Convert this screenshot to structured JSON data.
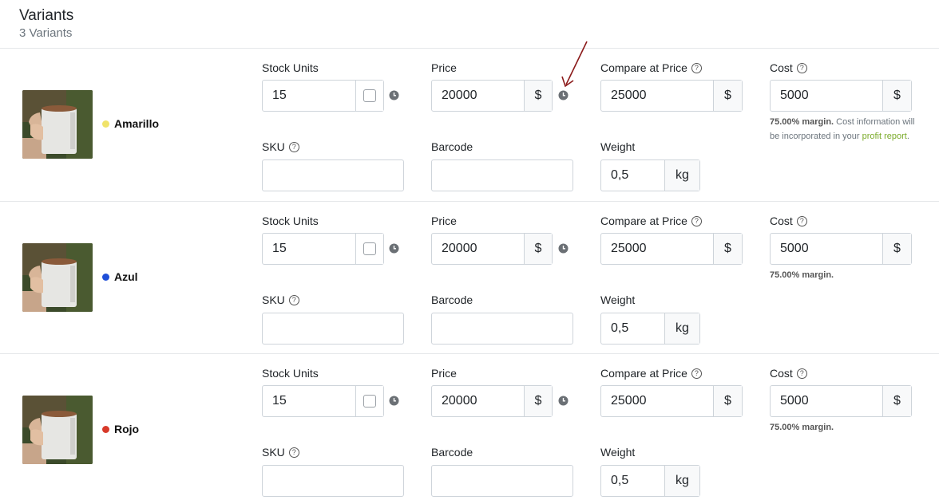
{
  "header": {
    "title": "Variants",
    "subtitle": "3 Variants"
  },
  "labels": {
    "stock_units": "Stock Units",
    "price": "Price",
    "compare_at_price": "Compare at Price",
    "cost": "Cost",
    "sku": "SKU",
    "barcode": "Barcode",
    "weight": "Weight",
    "currency": "$",
    "weight_unit": "kg"
  },
  "colors": {
    "accent_link": "#7bab2b",
    "arrow": "#8b1a1a"
  },
  "variants": [
    {
      "name": "Amarillo",
      "color": "#f0e36a",
      "stock": "15",
      "price": "20000",
      "compare_price": "25000",
      "cost": "5000",
      "sku": "",
      "barcode": "",
      "weight": "0,5",
      "margin": "75.00% margin.",
      "margin_note": " Cost information will be incorporated in your ",
      "margin_link": "profit report",
      "margin_end": "."
    },
    {
      "name": "Azul",
      "color": "#1f4fd8",
      "stock": "15",
      "price": "20000",
      "compare_price": "25000",
      "cost": "5000",
      "sku": "",
      "barcode": "",
      "weight": "0,5",
      "margin": "75.00% margin."
    },
    {
      "name": "Rojo",
      "color": "#d83a2a",
      "stock": "15",
      "price": "20000",
      "compare_price": "25000",
      "cost": "5000",
      "sku": "",
      "barcode": "",
      "weight": "0,5",
      "margin": "75.00% margin."
    }
  ]
}
